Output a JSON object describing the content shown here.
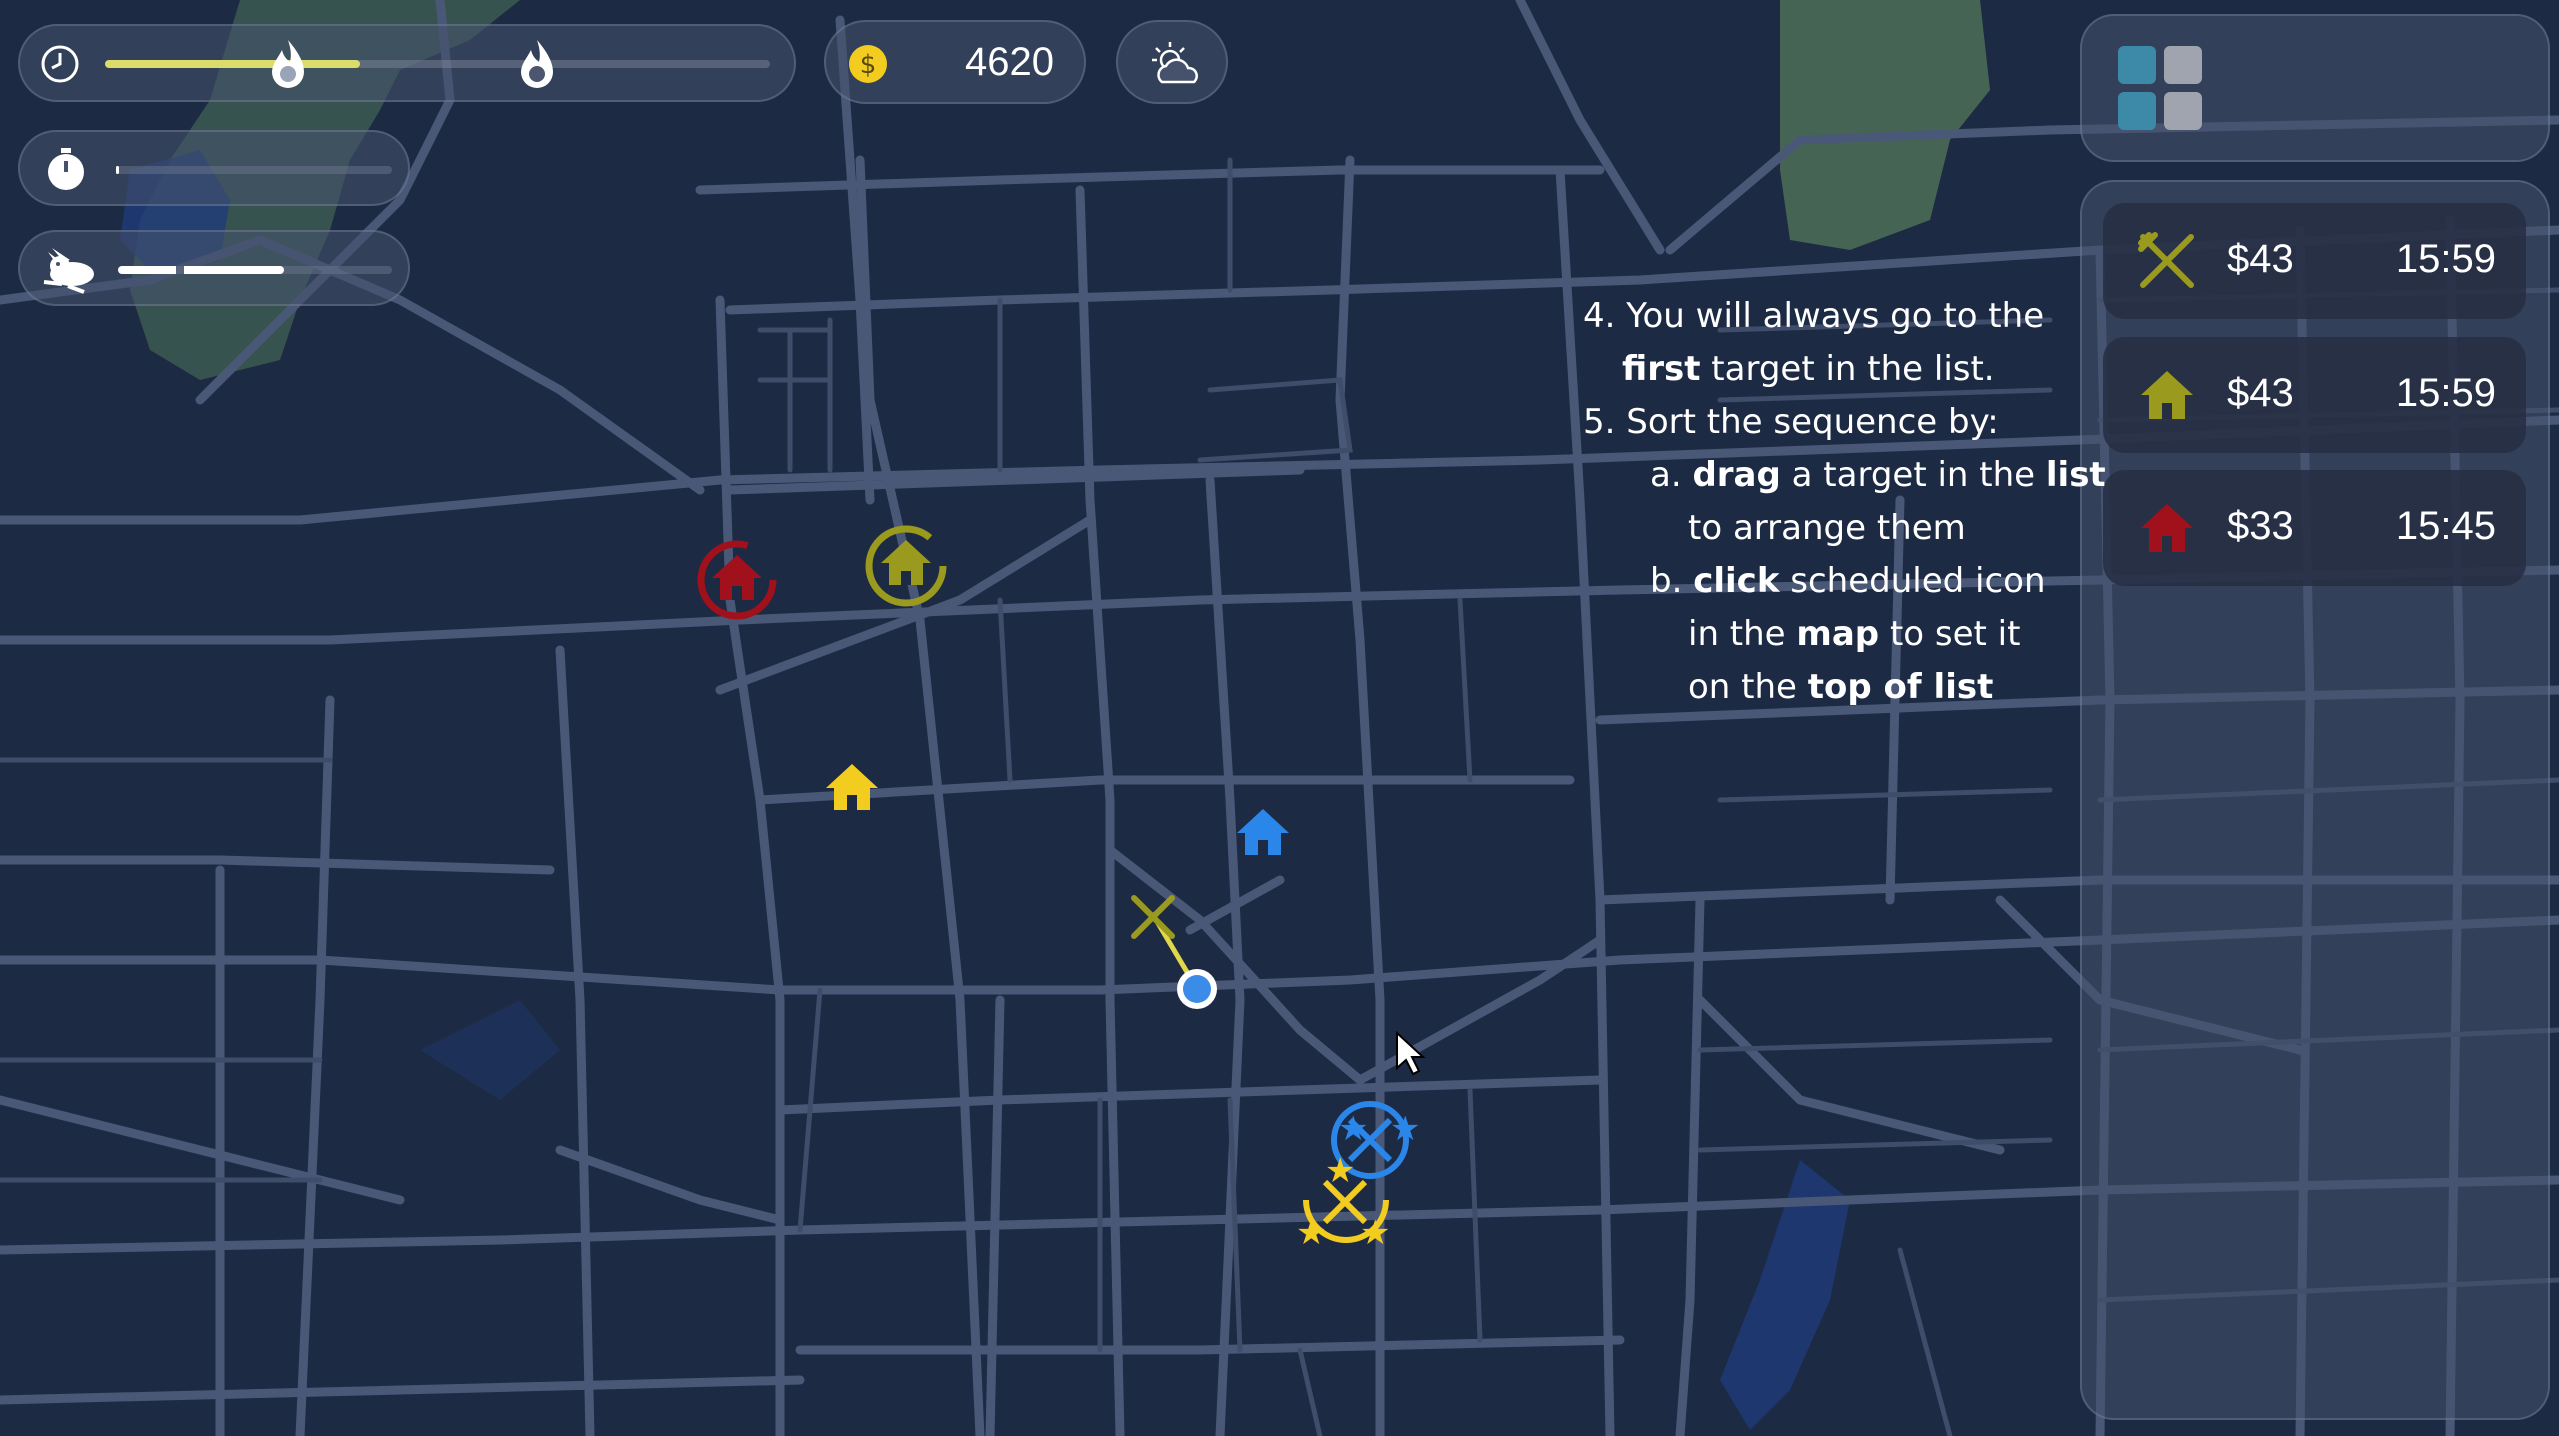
{
  "hud": {
    "money": "4620",
    "fuel_level": 0.6,
    "timer_level": 0.01,
    "speed_level": 0.35
  },
  "instructions": {
    "l1": "4. You will always go to the",
    "l2a": "first",
    "l2b": " target in the list.",
    "l3": "5. Sort the sequence by:",
    "l4a": "a. ",
    "l4b": "drag",
    "l4c": " a target in the ",
    "l4d": "list",
    "l5": "to arrange them",
    "l6a": "b. ",
    "l6b": "click",
    "l6c": " scheduled icon",
    "l7a": "in the ",
    "l7b": "map",
    "l7c": " to set it",
    "l8a": "on the ",
    "l8b": "top of list"
  },
  "targets": [
    {
      "icon": "fork-knife-icon",
      "color": "#9a9a1e",
      "price": "$43",
      "time": "15:59"
    },
    {
      "icon": "house-icon",
      "color": "#9a9a1e",
      "price": "$43",
      "time": "15:59"
    },
    {
      "icon": "house-icon",
      "color": "#a0111c",
      "price": "$33",
      "time": "15:45"
    }
  ],
  "colors": {
    "map_bg": "#1d2a44",
    "road": "#4a5878",
    "accent_yellow": "#e0d84a",
    "blue": "#2a86e8",
    "dark_red": "#a0111c",
    "olive": "#9a9a1e",
    "gold": "#f2cc1f"
  }
}
